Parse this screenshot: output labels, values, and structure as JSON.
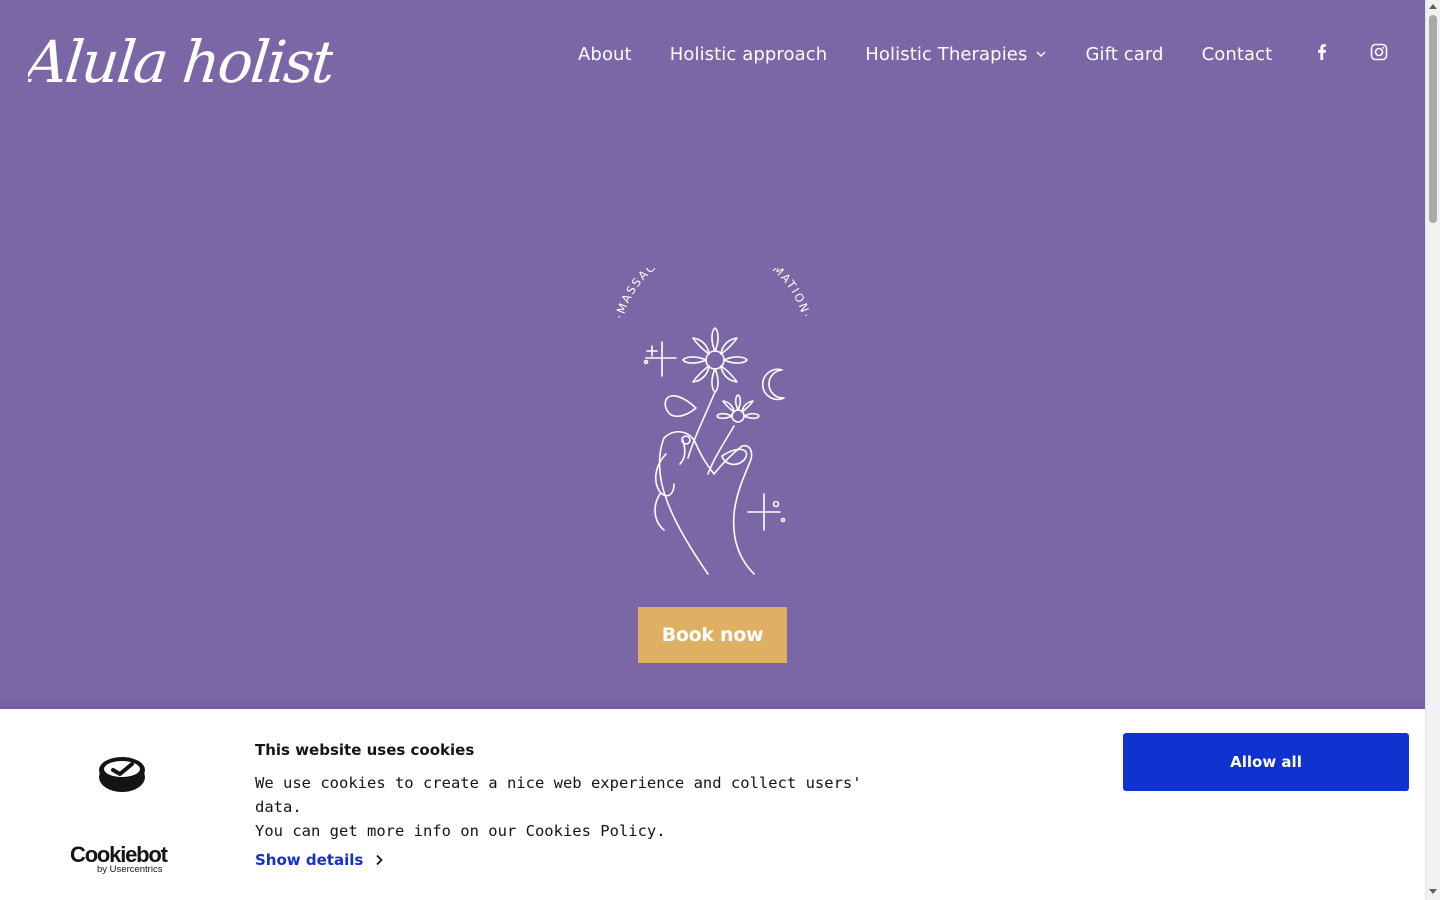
{
  "header": {
    "logo_text": "Alula holistic",
    "nav": [
      {
        "label": "About"
      },
      {
        "label": "Holistic approach"
      },
      {
        "label": "Holistic Therapies",
        "has_dropdown": true
      },
      {
        "label": "Gift card"
      },
      {
        "label": "Contact"
      }
    ],
    "social": [
      "facebook-icon",
      "instagram-icon"
    ]
  },
  "hero": {
    "emblem_text": "·MASSAGE FOR TRANSFORMATION·",
    "book_button": "Book now"
  },
  "cookie_banner": {
    "title": "This website uses cookies",
    "line1": "We use cookies to create a nice web experience and collect users' data.",
    "line2": "You can get more info on our Cookies Policy.",
    "show_details": "Show details",
    "allow_all": "Allow all",
    "brand": "Cookiebot",
    "brand_by": "by Usercentrics"
  },
  "colors": {
    "background": "#7b66a6",
    "book_button": "#dfb063",
    "accent_blue": "#1032cf"
  }
}
